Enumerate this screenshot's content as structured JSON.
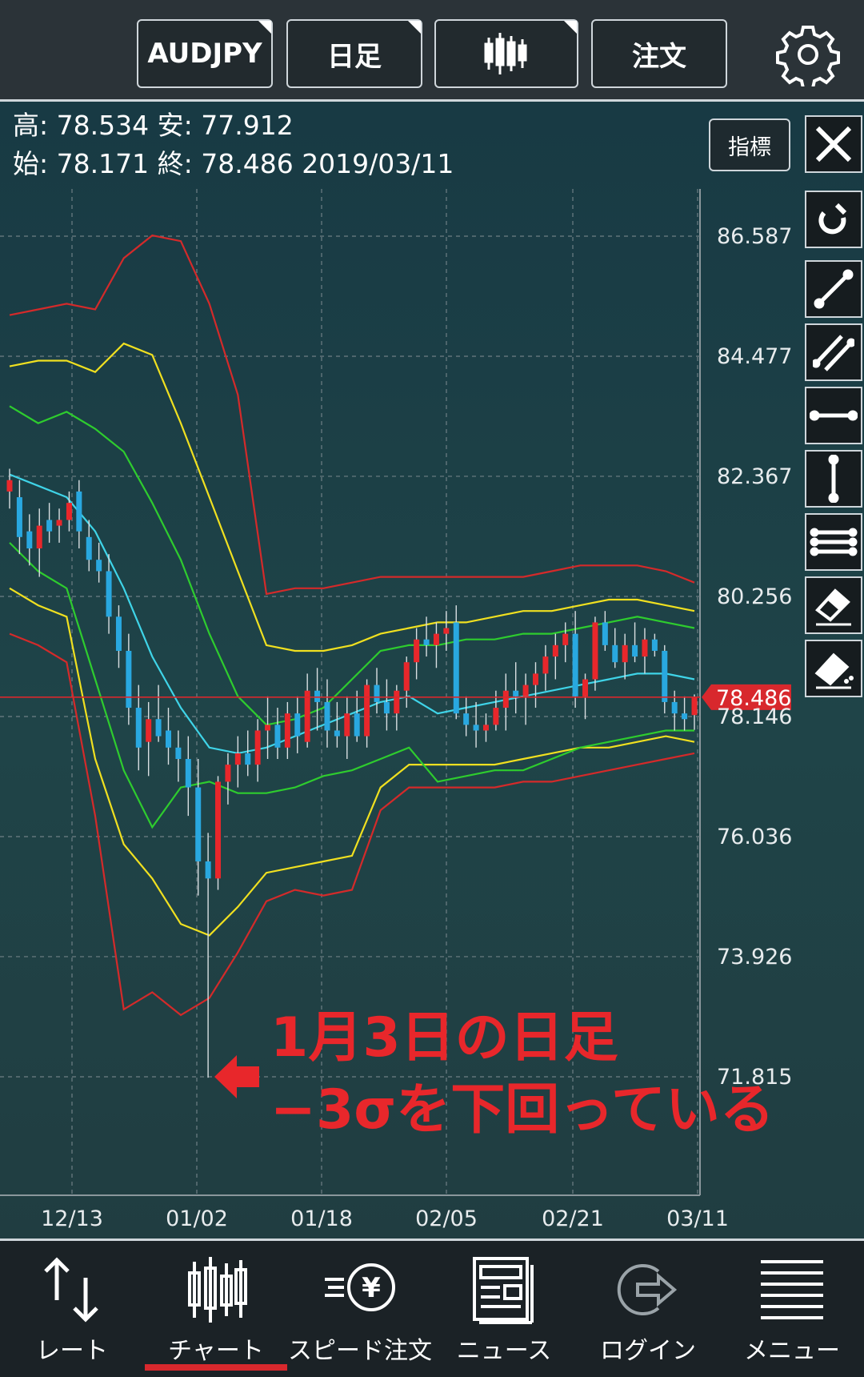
{
  "topbar": {
    "symbol": "AUDJPY",
    "period": "日足",
    "order": "注文",
    "chart_type_icon": "candlestick-icon",
    "settings_icon": "gear-icon"
  },
  "ohlc": {
    "high_label": "高:",
    "high": "78.534",
    "low_label": "安:",
    "low": "77.912",
    "open_label": "始:",
    "open": "78.171",
    "close_label": "終:",
    "close": "78.486",
    "date": "2019/03/11"
  },
  "indicator_button": "指標",
  "tools": [
    "close-icon",
    "magnet-icon",
    "trendline-icon",
    "parallel-lines-icon",
    "horizontal-line-icon",
    "vertical-line-icon",
    "multi-line-icon",
    "eraser-icon",
    "clear-all-icon"
  ],
  "annotation": {
    "line1": "1月3日の日足",
    "line2": "−3σを下回っている",
    "color": "#e8272b"
  },
  "nav": {
    "items": [
      {
        "label": "レート",
        "icon": "updown-arrow-icon"
      },
      {
        "label": "チャート",
        "icon": "candlestick-icon"
      },
      {
        "label": "スピード注文",
        "icon": "speed-yen-icon"
      },
      {
        "label": "ニュース",
        "icon": "newspaper-icon"
      },
      {
        "label": "ログイン",
        "icon": "login-icon"
      },
      {
        "label": "メニュー",
        "icon": "menu-icon"
      }
    ],
    "active": 1,
    "active_color": "#d8282d"
  },
  "chart_data": {
    "type": "candlestick",
    "y_ticks": [
      "86.587",
      "84.477",
      "82.367",
      "80.256",
      "78.146",
      "76.036",
      "73.926",
      "71.815"
    ],
    "x_ticks": [
      "12/13",
      "01/02",
      "01/18",
      "02/05",
      "02/21",
      "03/11"
    ],
    "current_price": "78.486",
    "current_price_color": "#d8282d",
    "ylim": [
      71.0,
      87.5
    ],
    "up_color": "#e8272b",
    "down_color": "#29a8e0",
    "bollinger": {
      "colors": {
        "mid": "#3fd4e8",
        "s1": "#2ecc2e",
        "s2": "#f0e020",
        "s3": "#d42a2a"
      },
      "x": [
        0,
        4,
        8,
        12,
        16,
        20,
        24,
        28,
        32,
        36,
        40,
        44,
        48,
        52,
        56,
        60,
        64,
        68,
        72,
        76,
        80,
        84,
        88,
        92,
        96
      ],
      "mid": [
        82.4,
        82.2,
        82.0,
        81.4,
        80.4,
        79.2,
        78.3,
        77.6,
        77.5,
        77.6,
        77.8,
        78.0,
        78.2,
        78.4,
        78.5,
        78.2,
        78.3,
        78.4,
        78.5,
        78.6,
        78.7,
        78.8,
        78.9,
        78.9,
        78.8
      ],
      "s1": [
        83.6,
        83.3,
        83.5,
        83.2,
        82.8,
        81.9,
        80.9,
        79.6,
        78.5,
        78.0,
        78.1,
        78.3,
        78.8,
        79.3,
        79.4,
        79.4,
        79.5,
        79.5,
        79.6,
        79.6,
        79.7,
        79.8,
        79.9,
        79.8,
        79.7
      ],
      "s2": [
        84.3,
        84.4,
        84.4,
        84.2,
        84.7,
        84.5,
        83.3,
        82.0,
        80.7,
        79.4,
        79.3,
        79.3,
        79.4,
        79.6,
        79.7,
        79.8,
        79.8,
        79.9,
        80.0,
        80.0,
        80.1,
        80.2,
        80.2,
        80.1,
        80.0
      ],
      "s3": [
        85.2,
        85.3,
        85.4,
        85.3,
        86.2,
        86.6,
        86.5,
        85.4,
        83.8,
        80.3,
        80.4,
        80.4,
        80.5,
        80.6,
        80.6,
        80.6,
        80.6,
        80.6,
        80.6,
        80.7,
        80.8,
        80.8,
        80.8,
        80.7,
        80.5
      ],
      "m1": [
        81.2,
        80.7,
        80.4,
        78.8,
        77.2,
        76.2,
        76.9,
        77.0,
        76.8,
        76.8,
        76.9,
        77.1,
        77.2,
        77.4,
        77.6,
        77.0,
        77.1,
        77.2,
        77.2,
        77.4,
        77.6,
        77.7,
        77.8,
        77.9,
        77.9
      ],
      "m2": [
        80.4,
        80.1,
        79.9,
        77.4,
        75.9,
        75.3,
        74.5,
        74.3,
        74.8,
        75.4,
        75.5,
        75.6,
        75.7,
        76.9,
        77.3,
        77.3,
        77.3,
        77.3,
        77.4,
        77.5,
        77.6,
        77.6,
        77.7,
        77.8,
        77.7
      ],
      "m3": [
        79.6,
        79.4,
        79.1,
        76.4,
        73.0,
        73.3,
        72.9,
        73.2,
        74.0,
        74.9,
        75.1,
        75.0,
        75.1,
        76.5,
        76.9,
        76.9,
        76.9,
        76.9,
        77.0,
        77.0,
        77.1,
        77.2,
        77.3,
        77.4,
        77.5
      ]
    },
    "candles": [
      [
        82.1,
        82.5,
        81.8,
        82.3
      ],
      [
        82.0,
        82.3,
        81.0,
        81.3
      ],
      [
        81.4,
        81.7,
        80.8,
        81.1
      ],
      [
        81.1,
        81.8,
        80.6,
        81.5
      ],
      [
        81.6,
        81.9,
        81.2,
        81.4
      ],
      [
        81.5,
        81.8,
        81.2,
        81.6
      ],
      [
        81.6,
        82.1,
        81.4,
        81.9
      ],
      [
        82.1,
        82.3,
        81.1,
        81.4
      ],
      [
        81.3,
        81.6,
        80.7,
        80.9
      ],
      [
        80.9,
        81.2,
        80.5,
        80.7
      ],
      [
        80.7,
        81.0,
        79.6,
        79.9
      ],
      [
        79.9,
        80.1,
        79.0,
        79.3
      ],
      [
        79.3,
        79.6,
        78.0,
        78.3
      ],
      [
        78.3,
        78.7,
        77.2,
        77.6
      ],
      [
        77.7,
        78.4,
        77.1,
        78.1
      ],
      [
        78.1,
        78.7,
        77.7,
        77.8
      ],
      [
        77.9,
        78.3,
        77.3,
        77.6
      ],
      [
        77.6,
        77.9,
        77.0,
        77.4
      ],
      [
        77.4,
        77.8,
        76.4,
        76.9
      ],
      [
        76.9,
        77.4,
        75.0,
        75.6
      ],
      [
        75.6,
        76.1,
        71.8,
        75.3
      ],
      [
        75.3,
        77.1,
        75.1,
        77.0
      ],
      [
        77.0,
        77.5,
        76.6,
        77.3
      ],
      [
        77.3,
        77.8,
        76.9,
        77.5
      ],
      [
        77.5,
        77.9,
        77.1,
        77.3
      ],
      [
        77.3,
        78.1,
        77.0,
        77.9
      ],
      [
        77.9,
        78.5,
        77.4,
        78.0
      ],
      [
        78.0,
        78.3,
        77.4,
        77.6
      ],
      [
        77.6,
        78.4,
        77.4,
        78.2
      ],
      [
        78.2,
        78.5,
        77.5,
        77.8
      ],
      [
        77.7,
        78.9,
        77.6,
        78.6
      ],
      [
        78.6,
        79.0,
        77.9,
        78.4
      ],
      [
        78.4,
        78.8,
        77.6,
        77.9
      ],
      [
        77.9,
        78.4,
        77.6,
        77.8
      ],
      [
        77.8,
        78.5,
        77.4,
        78.2
      ],
      [
        78.2,
        78.6,
        77.7,
        77.8
      ],
      [
        77.8,
        78.8,
        77.6,
        78.7
      ],
      [
        78.7,
        79.0,
        78.2,
        78.4
      ],
      [
        78.4,
        78.8,
        77.9,
        78.2
      ],
      [
        78.2,
        78.7,
        77.9,
        78.6
      ],
      [
        78.6,
        79.2,
        78.3,
        79.1
      ],
      [
        79.1,
        79.7,
        78.8,
        79.5
      ],
      [
        79.5,
        79.9,
        79.2,
        79.4
      ],
      [
        79.4,
        79.8,
        79.0,
        79.6
      ],
      [
        79.6,
        80.0,
        79.3,
        79.7
      ],
      [
        79.8,
        80.1,
        78.1,
        78.2
      ],
      [
        78.2,
        78.5,
        77.8,
        78.0
      ],
      [
        78.0,
        78.4,
        77.6,
        77.9
      ],
      [
        77.9,
        78.2,
        77.7,
        78.0
      ],
      [
        78.0,
        78.6,
        77.9,
        78.3
      ],
      [
        78.3,
        78.9,
        77.9,
        78.6
      ],
      [
        78.6,
        79.1,
        78.2,
        78.5
      ],
      [
        78.5,
        78.9,
        78.0,
        78.7
      ],
      [
        78.7,
        79.1,
        78.3,
        78.9
      ],
      [
        78.9,
        79.4,
        78.6,
        79.2
      ],
      [
        79.2,
        79.6,
        78.8,
        79.4
      ],
      [
        79.4,
        79.8,
        79.1,
        79.6
      ],
      [
        79.6,
        80.0,
        78.3,
        78.5
      ],
      [
        78.5,
        78.9,
        78.1,
        78.8
      ],
      [
        78.8,
        79.9,
        78.6,
        79.8
      ],
      [
        79.8,
        80.0,
        79.3,
        79.4
      ],
      [
        79.4,
        79.7,
        79.0,
        79.1
      ],
      [
        79.1,
        79.6,
        78.8,
        79.4
      ],
      [
        79.4,
        79.8,
        79.1,
        79.2
      ],
      [
        79.2,
        79.7,
        78.9,
        79.5
      ],
      [
        79.5,
        79.6,
        79.2,
        79.3
      ],
      [
        79.3,
        79.4,
        78.2,
        78.4
      ],
      [
        78.4,
        78.6,
        77.9,
        78.2
      ],
      [
        78.2,
        78.5,
        77.9,
        78.1
      ],
      [
        78.171,
        78.534,
        77.912,
        78.486
      ]
    ]
  }
}
